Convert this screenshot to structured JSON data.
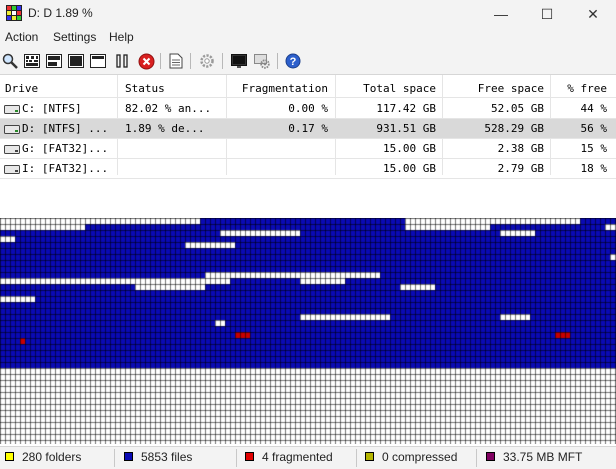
{
  "window": {
    "title": "D:  D   1.89 %",
    "minimize": "—",
    "maximize": "☐",
    "close": "✕"
  },
  "menu": [
    "Action",
    "Settings",
    "Help"
  ],
  "toolbar": [
    {
      "name": "analyze-icon"
    },
    {
      "name": "defrag-icon"
    },
    {
      "name": "quick-optimization-icon"
    },
    {
      "name": "full-optimization-icon"
    },
    {
      "name": "mft-optimization-icon"
    },
    {
      "name": "pause-icon"
    },
    {
      "name": "stop-icon"
    },
    {
      "name": "report-icon"
    },
    {
      "name": "settings-icon"
    },
    {
      "name": "boot-time-icon"
    },
    {
      "name": "boot-time-settings-icon"
    },
    {
      "name": "help-icon"
    }
  ],
  "table": {
    "headers": [
      "Drive",
      "Status",
      "Fragmentation",
      "Total space",
      "Free space",
      "% free"
    ],
    "rows": [
      {
        "drive": "C: [NTFS]",
        "status": "82.02 % an...",
        "fragmentation": "0.00 %",
        "total": "117.42 GB",
        "free": "52.05 GB",
        "pct": "44 %",
        "selected": false
      },
      {
        "drive": "D: [NTFS] ...",
        "status": "1.89 % de...",
        "fragmentation": "0.17 %",
        "total": "931.51 GB",
        "free": "528.29 GB",
        "pct": "56 %",
        "selected": true
      },
      {
        "drive": "G: [FAT32]...",
        "status": "",
        "fragmentation": "",
        "total": "15.00 GB",
        "free": "2.38 GB",
        "pct": "15 %",
        "selected": false
      },
      {
        "drive": "I: [FAT32]...",
        "status": "",
        "fragmentation": "",
        "total": "15.00 GB",
        "free": "2.79 GB",
        "pct": "18 %",
        "selected": false
      }
    ]
  },
  "cluster_map": {
    "colors": {
      "free": "#ffffff",
      "used": "#0a0ab4",
      "fragmented": "#c80000",
      "grid": "#000000"
    }
  },
  "status": [
    {
      "label": "280 folders",
      "color": "#ffff00"
    },
    {
      "label": "5853 files",
      "color": "#0a0ab4"
    },
    {
      "label": "4 fragmented",
      "color": "#e00000"
    },
    {
      "label": "0 compressed",
      "color": "#b4b400"
    },
    {
      "label": "33.75 MB MFT",
      "color": "#800060"
    }
  ]
}
